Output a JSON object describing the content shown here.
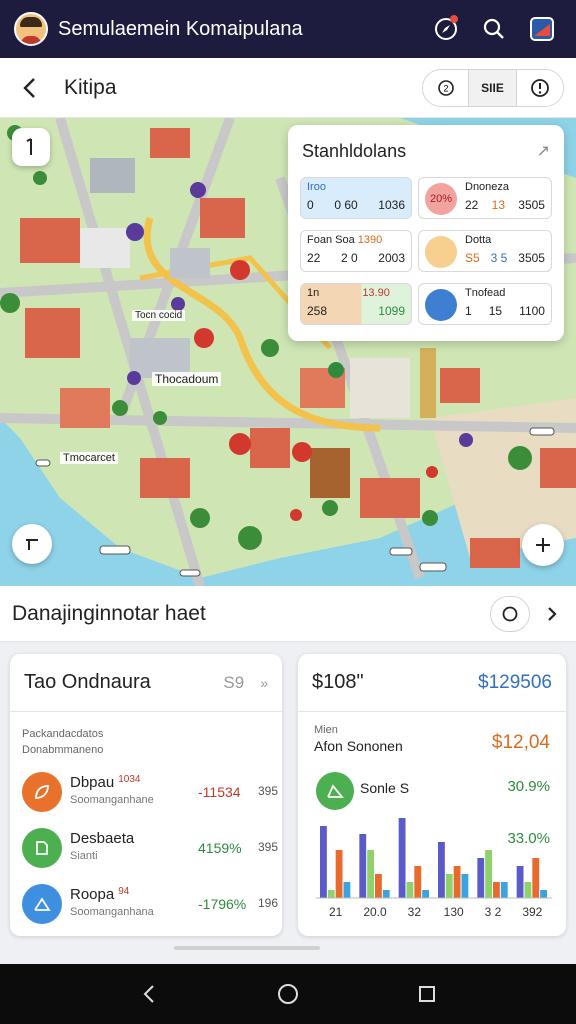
{
  "app": {
    "title": "Semulaemein Komaipulana"
  },
  "header": {
    "title": "Kitipa",
    "seg": {
      "b1": "Ⓒ",
      "b2": "SIIE",
      "b3": "!"
    }
  },
  "stats": {
    "title": "Stanhldolans",
    "c1": {
      "label": "Iroo",
      "v1": "0",
      "v2": "0 60",
      "v3": "1036"
    },
    "c2": {
      "ic": "20%",
      "label": "Dnoneza",
      "v1": "22",
      "v2": "13",
      "v3": "3505"
    },
    "c3": {
      "label": "Foan Soa",
      "tag": "1390",
      "v1": "22",
      "v2": "2 0",
      "v3": "2003"
    },
    "c4": {
      "ic": "Dotta",
      "v1": "S5",
      "v2": "3 5",
      "v3": "3505"
    },
    "c5": {
      "label": "1n",
      "tag": "13.90",
      "v1": "258",
      "v2": "1099"
    },
    "c6": {
      "label": "Tnofead",
      "v1": "1",
      "v2": "15",
      "v3": "1100"
    }
  },
  "map_labels": {
    "l1": "Tocn cocid",
    "l2": "Thocadoum",
    "l3": "Tmocarcet"
  },
  "section": {
    "title": "Danajinginnotar haet"
  },
  "card_left": {
    "title": "Tao Ondnaura",
    "badge": "S9",
    "sub1": "Packandacdatos",
    "sub2": "Donabmmaneno",
    "rows": [
      {
        "name": "Dbpau",
        "tag": "1034",
        "sub": "Soomanganhane",
        "val": "-11534",
        "val2": "395"
      },
      {
        "name": "Desbaeta",
        "tag": "",
        "sub": "Sianti",
        "val": "4159%",
        "val2": "395"
      },
      {
        "name": "Roopa",
        "tag": "94",
        "sub": "Soomanganhana",
        "val": "-1796%",
        "val2": "196"
      }
    ]
  },
  "card_right": {
    "title": "$108\"",
    "value": "$129506",
    "sub_label": "Afon Sononen",
    "sub_top": "Mien",
    "sub_value": "$12,04",
    "legend_name": "Sonle S",
    "legend_pct1": "30.9%",
    "legend_pct2": "33.0%",
    "x_labels": [
      "21",
      "20.0",
      "32",
      "130",
      "3 2",
      "392"
    ]
  },
  "colors": {
    "appbar": "#1d1c3f",
    "accent_blue": "#2f6fc4",
    "accent_orange": "#d96b1f",
    "accent_green": "#2e8b3e",
    "negative": "#c0392b"
  },
  "chart_data": {
    "type": "bar",
    "categories": [
      "21",
      "20.0",
      "32",
      "130",
      "3 2",
      "392"
    ],
    "series": [
      {
        "name": "",
        "values": [
          9,
          8,
          10,
          7,
          5,
          4
        ]
      },
      {
        "name": "",
        "values": [
          1,
          6,
          2,
          3,
          6,
          2
        ]
      },
      {
        "name": "",
        "values": [
          6,
          3,
          4,
          4,
          2,
          5
        ]
      },
      {
        "name": "",
        "values": [
          2,
          1,
          1,
          3,
          2,
          1
        ]
      }
    ],
    "ylim": [
      0,
      10
    ],
    "grid": false,
    "colors": [
      "#5a5bc9",
      "#8fd16a",
      "#e86b2d",
      "#3ba3e0"
    ]
  }
}
